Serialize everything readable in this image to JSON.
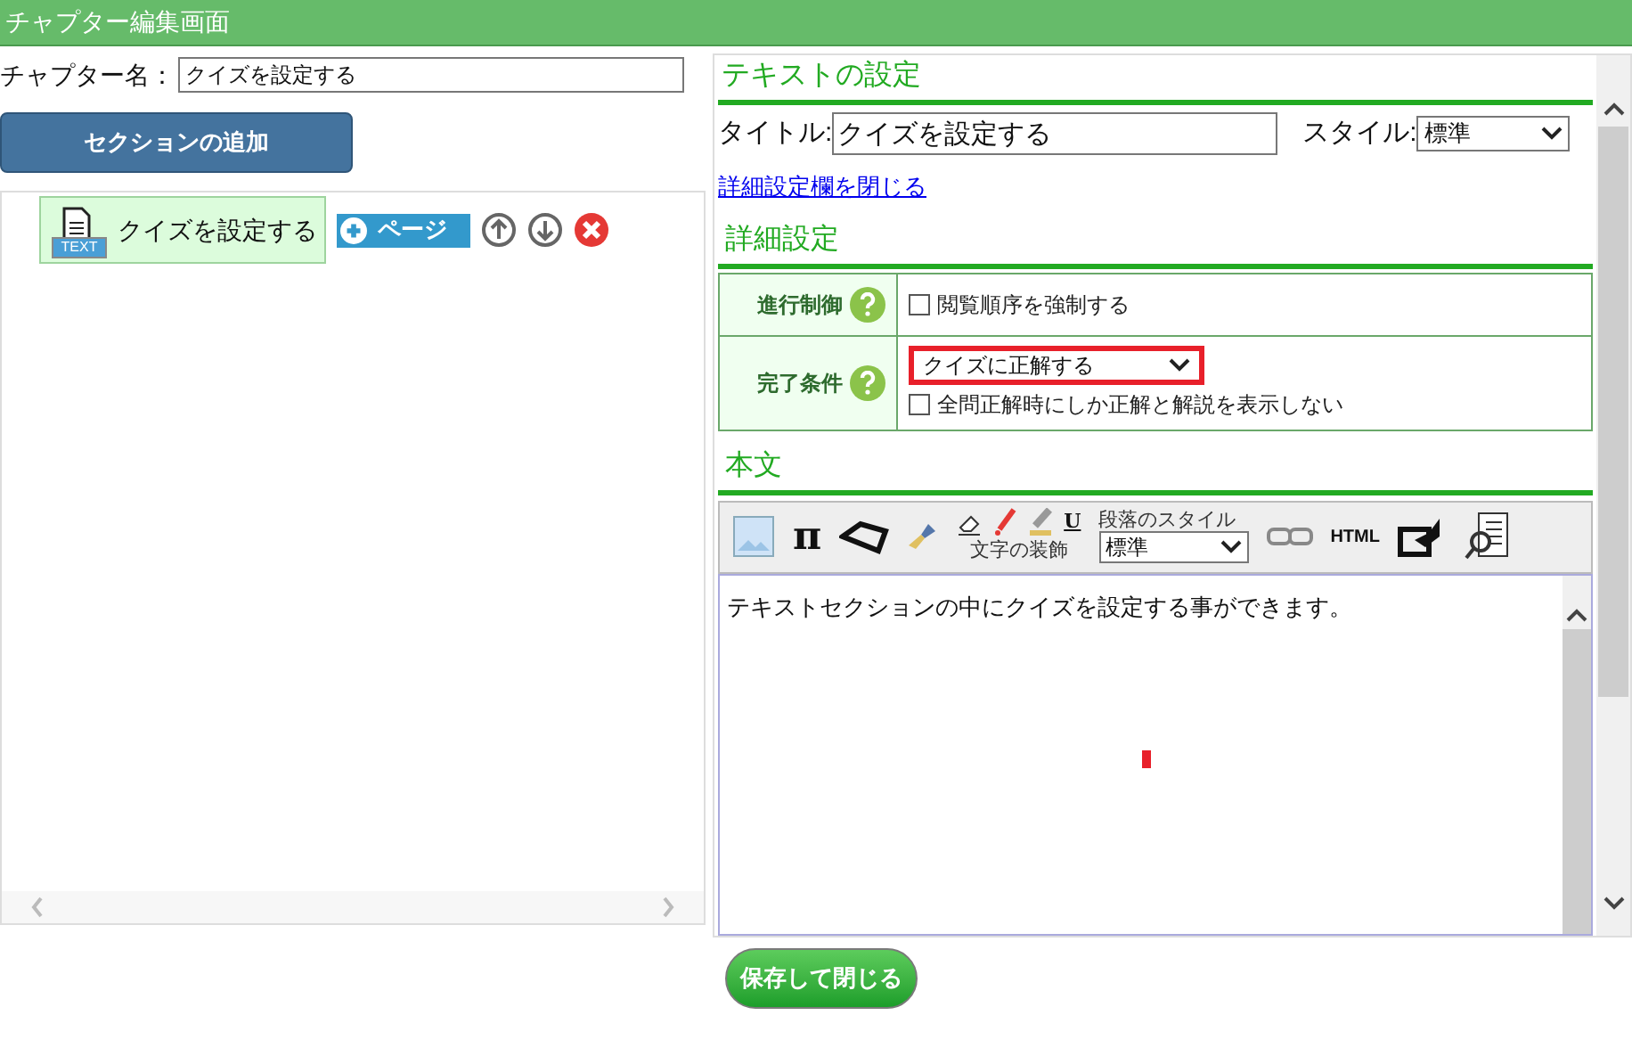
{
  "header": {
    "title": "チャプター編集画面"
  },
  "chapter_name": {
    "label": "チャプター名：",
    "value": "クイズを設定する"
  },
  "add_section_button": "セクションの追加",
  "sections": [
    {
      "badge": "TEXT",
      "title": "クイズを設定する",
      "page_button": "ページ"
    }
  ],
  "text_settings": {
    "heading": "テキストの設定",
    "title_label": "タイトル:",
    "title_value": "クイズを設定する",
    "style_label": "スタイル:",
    "style_value": "標準",
    "close_link": "詳細設定欄を閉じる"
  },
  "details": {
    "heading": "詳細設定",
    "rows": [
      {
        "label": "進行制御",
        "items": [
          {
            "kind": "checkbox",
            "checked": false,
            "text": "閲覧順序を強制する"
          }
        ]
      },
      {
        "label": "完了条件",
        "items": [
          {
            "kind": "select",
            "value": "クイズに正解する",
            "highlighted": true
          },
          {
            "kind": "checkbox",
            "checked": false,
            "text": "全問正解時にしか正解と解説を表示しない"
          }
        ]
      }
    ]
  },
  "body": {
    "heading": "本文",
    "decoration_label": "文字の装飾",
    "paragraph_label": "段落のスタイル",
    "paragraph_value": "標準",
    "html_button": "HTML",
    "math_button": "π",
    "underline_button": "U",
    "text": "テキストセクションの中にクイズを設定する事ができます。"
  },
  "save_button": "保存して閉じる"
}
